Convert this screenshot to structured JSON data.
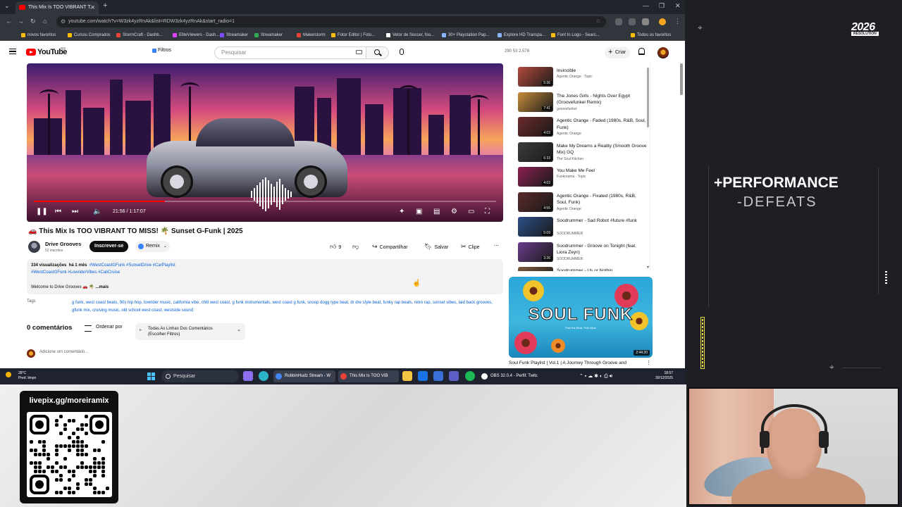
{
  "browser": {
    "tab_title": "This Mix Is TOO VIBRANT T...",
    "url": "youtube.com/watch?v=W3zk4yzRnAk&list=RDW3zk4yzRnAk&start_radio=1",
    "bookmarks": [
      {
        "label": "novos favoritos",
        "color": "#fbbc04"
      },
      {
        "label": "Cursos Comprados",
        "color": "#fbbc04"
      },
      {
        "label": "StormCraft - Dashb...",
        "color": "#ea4335"
      },
      {
        "label": "EliteViewers - Dash...",
        "color": "#e040fb"
      },
      {
        "label": "Streamaker",
        "color": "#7c4dff"
      },
      {
        "label": "Streamaker",
        "color": "#34a853"
      },
      {
        "label": "Makerstorm",
        "color": "#ea4335"
      },
      {
        "label": "Fotor Editor | Foto...",
        "color": "#fbbc04"
      },
      {
        "label": "Vetor de Soccer, foo...",
        "color": "#ffffff"
      },
      {
        "label": "30+ Playstation Pap...",
        "color": "#8ab4f8"
      },
      {
        "label": "Explore HD Transpa...",
        "color": "#8ab4f8"
      },
      {
        "label": "Font In Logo - Searc...",
        "color": "#fbbc04"
      },
      {
        "label": "Todos os favoritos",
        "color": "#fbbc04"
      }
    ]
  },
  "header": {
    "logo": "YouTube",
    "country": "BR",
    "filters": "Filtros",
    "search_placeholder": "Pesquisar",
    "stats": "290  53  2.578",
    "create": "Criar"
  },
  "video": {
    "time": "21:56 / 1:17:07",
    "progress": 0.284,
    "title": "🚗 This Mix Is TOO VIBRANT TO MISS! 🌴 Sunset G-Funk | 2025",
    "channel": "Drive Grooves",
    "subs": "52 inscritos",
    "subscribe": "Inscrever-se",
    "remix": "Remix",
    "likes": "9",
    "share": "Compartilhar",
    "save": "Salvar",
    "clip": "Clipe"
  },
  "description": {
    "views": "334 visualizações",
    "ago": "há 1 mês",
    "hashtags1": "#WestCoastGFunk #SunsetDrive #CarPlaylist",
    "hashtags2": "#WestCoastGFunk #LowriderVibes #CaliCruise",
    "welcome": "Welcome to Drive Grooves 🚗 🌴",
    "more": "...mais"
  },
  "tags": {
    "label": "Tags",
    "text": "g funk, west coast beats, 90s hip hop, lowrider music, california vibe, chill west coast, g funk instrumentals, west coast g funk, snoop dogg type beat, dr dre style beat, funky rap beats, retro rap, sunset vibes, laid back grooves, gfunk mix, cruising music, old school west coast, westside sound"
  },
  "comments": {
    "count": "0 comentários",
    "order": "Ordenar por",
    "select_line1": "Todas As Linhas Dos Comentários",
    "select_line2": "(Escolher Filtros)",
    "add": "Adicione um comentário..."
  },
  "sidebar": [
    {
      "title": "Invincible",
      "channel": "Agentic Orange · Topic",
      "duration": "5:36",
      "color": "#b44a3c"
    },
    {
      "title": "The Jones Girls - Nights Over Egypt (Groovefunkel Remix)",
      "channel": "groovefunkel",
      "duration": "7:41",
      "color": "#c98d3c"
    },
    {
      "title": "Agentic Orange - Faded (1980s, R&B, Soul, Funk)",
      "channel": "Agentic Orange",
      "duration": "4:03",
      "color": "#6b2a2a"
    },
    {
      "title": "Make My Dreams a Reality (Smooth Groove Mix) GQ",
      "channel": "The Soul Kitchen",
      "duration": "6:33",
      "color": "#3c3c3c"
    },
    {
      "title": "You Make Me Feel",
      "channel": "Funkorama · Topic",
      "duration": "4:03",
      "color": "#8a1f4f"
    },
    {
      "title": "Agentic Orange - Fixated (1980s, R&B, Soul, Funk)",
      "channel": "Agentic Orange",
      "duration": "4:55",
      "color": "#5a2a2a"
    },
    {
      "title": "Soodrummer - Sad Robot #future #funk",
      "channel": "SOODRUMMER",
      "duration": "5:09",
      "color": "#2d4e8a"
    },
    {
      "title": "Soodrummer - Groove on Tonight (feat. Liora Zeyn)",
      "channel": "SOODRUMMER",
      "duration": "3:26",
      "color": "#6a3d8c"
    },
    {
      "title": "Soodrummer - Us or Nothin",
      "channel": "",
      "duration": "",
      "color": "#7d5a3c"
    }
  ],
  "soul_card": {
    "heading": "SOUL FUNK",
    "sub": "Feel the Beat, Feel Alive",
    "duration": "2:44:20",
    "title": "Soul Funk Playlist | Vol.1 | A Journey Through Groove and"
  },
  "taskbar": {
    "temp": "28°C",
    "weather": "Pred. limpo",
    "search": "Pesquisar",
    "windows": [
      {
        "label": "RobbinHudz Stream - W",
        "color": "#4285f4"
      },
      {
        "label": "This Mix Is TOO VIB",
        "color": "#ea4335"
      },
      {
        "label": "OBS 32.0.4 - Perfil: Twitc",
        "color": "#ffffff"
      }
    ],
    "time": "18:57",
    "date": "30/12/2025"
  },
  "overlay": {
    "logo": "2026",
    "logo_sub": "RESOLUTION",
    "headline": "+PERFORMANCE",
    "subline": "-DEFEATS"
  },
  "qr_label": "livepix.gg/moreiramix"
}
